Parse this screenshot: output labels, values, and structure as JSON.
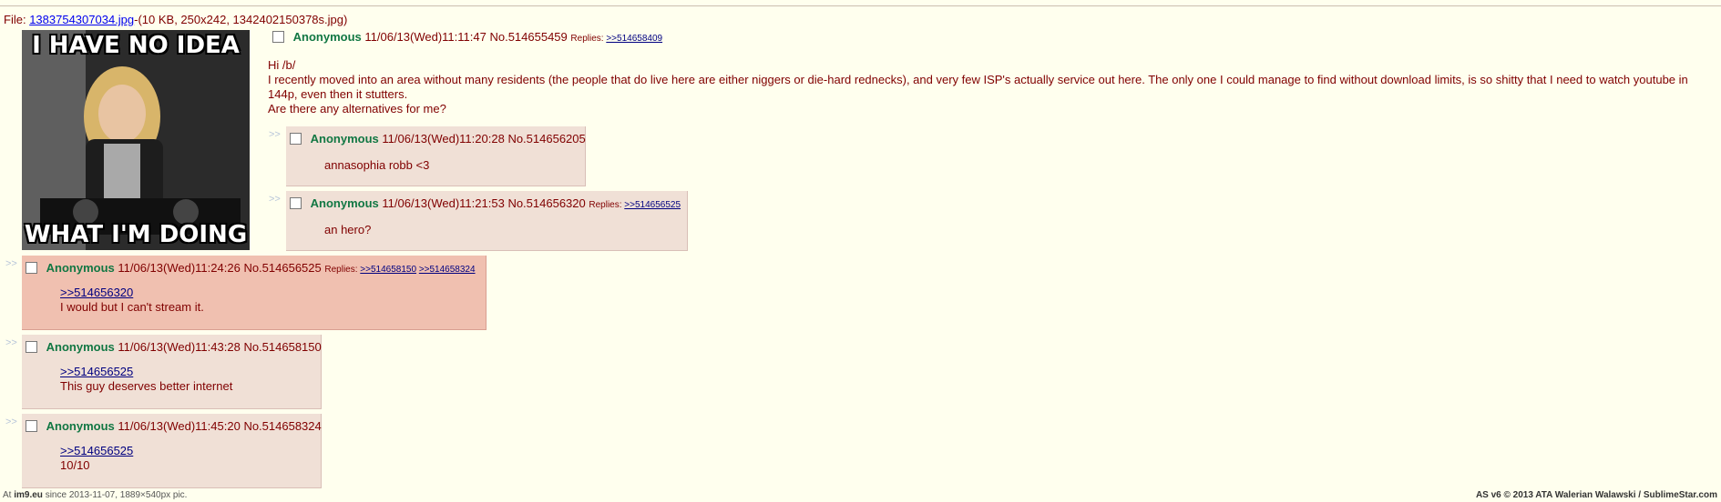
{
  "file": {
    "label": "File:",
    "filename": "1383754307034.jpg",
    "meta": "-(10 KB, 250x242, 1342402150378s.jpg)"
  },
  "image": {
    "top_text": "I HAVE NO IDEA",
    "bottom_text": "WHAT I'M DOING"
  },
  "op": {
    "name": "Anonymous",
    "datetime": "11/06/13(Wed)11:11:47",
    "number": "No.514655459",
    "replies_label": "Replies:",
    "replies": [
      ">>514658409"
    ],
    "lines": [
      "Hi /b/",
      "I recently moved into an area without many residents (the people that do live here are either niggers or die-hard rednecks), and very few ISP's actually service out here. The only one I could manage to find without download limits, is so shitty that I need to watch youtube in 144p, even then it stutters.",
      "Are there any alternatives for me?"
    ]
  },
  "arrow": ">>",
  "posts": [
    {
      "name": "Anonymous",
      "datetime": "11/06/13(Wed)11:20:28",
      "number": "No.514656205",
      "replies_label": "",
      "replies": [],
      "quote": "",
      "text": "annasophia robb <3"
    },
    {
      "name": "Anonymous",
      "datetime": "11/06/13(Wed)11:21:53",
      "number": "No.514656320",
      "replies_label": "Replies:",
      "replies": [
        ">>514656525"
      ],
      "quote": "",
      "text": "an hero?"
    },
    {
      "name": "Anonymous",
      "datetime": "11/06/13(Wed)11:24:26",
      "number": "No.514656525",
      "replies_label": "Replies:",
      "replies": [
        ">>514658150",
        ">>514658324"
      ],
      "quote": ">>514656320",
      "text": "I would but I can't stream it."
    },
    {
      "name": "Anonymous",
      "datetime": "11/06/13(Wed)11:43:28",
      "number": "No.514658150",
      "replies_label": "",
      "replies": [],
      "quote": ">>514656525",
      "text": "This guy deserves better internet"
    },
    {
      "name": "Anonymous",
      "datetime": "11/06/13(Wed)11:45:20",
      "number": "No.514658324",
      "replies_label": "",
      "replies": [],
      "quote": ">>514656525",
      "text": "10/10"
    }
  ],
  "footer": {
    "left_prefix": "At",
    "left_site": "im9.eu",
    "left_suffix": "since 2013-11-07, 1889×540px pic.",
    "right": "AS v6 © 2013 ATA Walerian Walawski / SublimeStar.com"
  },
  "colors": {
    "background": "#ffffee",
    "post_bg": "#f0e0d6",
    "highlight_bg": "#f0c0b0",
    "name": "#117743",
    "text": "#800000",
    "link": "#000080"
  }
}
